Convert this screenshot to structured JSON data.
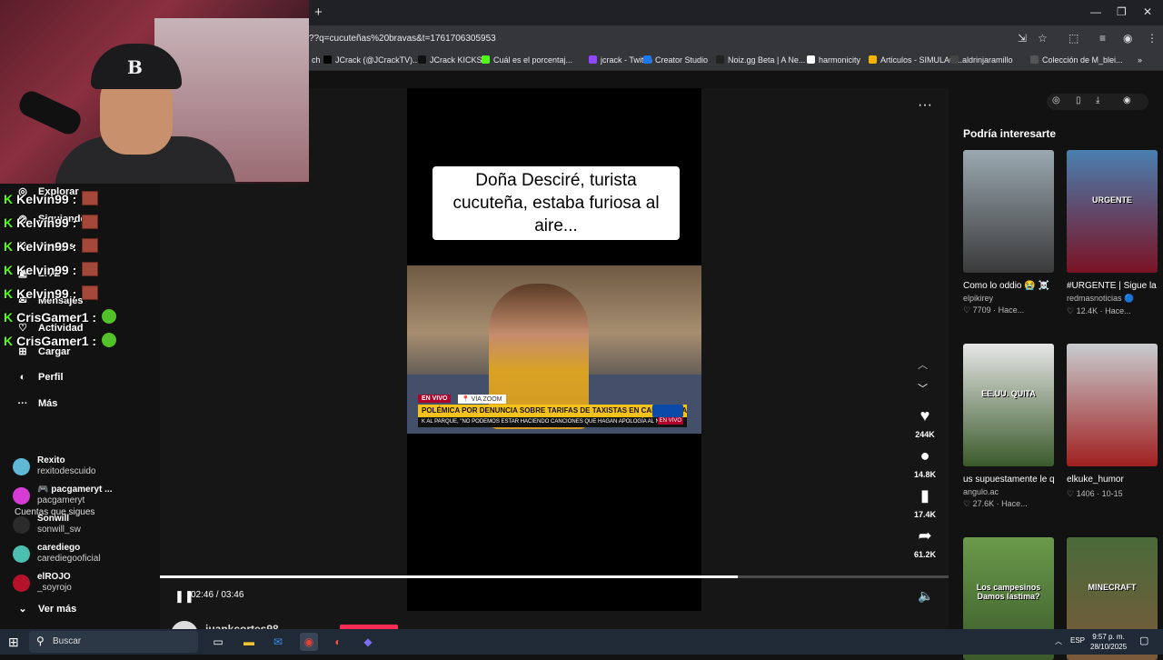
{
  "browser": {
    "new_tab_glyph": "+",
    "url": "??q=cucuteñas%20bravas&t=1761706305953",
    "window_controls": [
      "—",
      "❐",
      "✕"
    ],
    "bookmarks": [
      {
        "label": "ch",
        "color": "#555555"
      },
      {
        "label": "JCrack (@JCrackTV)...",
        "color": "#000000"
      },
      {
        "label": "JCrack KICKS",
        "color": "#111111"
      },
      {
        "label": "Cuál es el porcentaj...",
        "color": "#53fc18"
      },
      {
        "label": "jcrack - Twitch",
        "color": "#9146ff"
      },
      {
        "label": "Creator Studio",
        "color": "#1877f2"
      },
      {
        "label": "Noiz.gg Beta | A Ne...",
        "color": "#222222"
      },
      {
        "label": "harmonicity",
        "color": "#ffffff"
      },
      {
        "label": "Articulos - SIMULAC...",
        "color": "#f4b400"
      },
      {
        "label": "aldrinjaramillo",
        "color": "#444444"
      },
      {
        "label": "Colección de M_blei...",
        "color": "#555555"
      }
    ],
    "bookmarks_overflow": "»"
  },
  "sidebar": {
    "nav": [
      {
        "icon": "compass-icon",
        "glyph": "◎",
        "label": "Explorar"
      },
      {
        "icon": "following-icon",
        "glyph": "◉",
        "label": "Siguiendo"
      },
      {
        "icon": "friends-icon",
        "glyph": "⚇",
        "label": "Amigos"
      },
      {
        "icon": "live-icon",
        "glyph": "▣",
        "label": "LIVE"
      },
      {
        "icon": "messages-icon",
        "glyph": "✉",
        "label": "Mensajes"
      },
      {
        "icon": "activity-icon",
        "glyph": "♡",
        "label": "Actividad"
      },
      {
        "icon": "upload-icon",
        "glyph": "⊞",
        "label": "Cargar"
      },
      {
        "icon": "profile-icon",
        "glyph": "◐",
        "label": "Perfil"
      },
      {
        "icon": "more-icon",
        "glyph": "···",
        "label": "Más"
      }
    ],
    "following_title": "Cuentas que sigues",
    "accounts": [
      {
        "name": "Rexito",
        "handle": "rexitodescuido",
        "color": "#5fb8d6"
      },
      {
        "name": "🎮 pacgameryt ...",
        "handle": "pacgameryt",
        "color": "#d63bd6"
      },
      {
        "name": "Sonwill",
        "handle": "sonwill_sw",
        "color": "#2b2b2b"
      },
      {
        "name": "carediego",
        "handle": "carediegooficial",
        "color": "#4dbfb0"
      },
      {
        "name": "elROJO",
        "handle": "_soyrojo",
        "color": "#b3122a"
      }
    ],
    "see_more": "Ver más",
    "see_more_glyph": "⌄"
  },
  "chat": [
    {
      "user": "Kelvin99 :",
      "emote": "box"
    },
    {
      "user": "Kelvin99 :",
      "emote": "box"
    },
    {
      "user": "Kelvin99 :",
      "emote": "box"
    },
    {
      "user": "Kelvin99 :",
      "emote": "box"
    },
    {
      "user": "Kelvin99 :",
      "emote": "box"
    },
    {
      "user": "CrisGamer1 :",
      "emote": "green"
    },
    {
      "user": "CrisGamer1 :",
      "emote": "green"
    }
  ],
  "player": {
    "caption": "Doña Desciré, turista cucuteña, estaba furiosa al aire...",
    "lower_third": {
      "badge": "EN VIVO",
      "via": "📍 VÍA ZOOM",
      "headline": "POLÉMICA POR DENUNCIA SOBRE TARIFAS DE TAXISTAS EN CARTAGENA",
      "ticker": "K AL PARQUE, \"NO PODEMOS ESTAR HACIENDO CANCIONES QUE HAGAN APOLOGÍA AL NAR",
      "badge2": "EN VIVO"
    },
    "more_glyph": "···",
    "likes": "244K",
    "comments": "14.8K",
    "saves": "17.4K",
    "shares": "61.2K",
    "time": "02:46 / 03:46",
    "progress": 0.733,
    "pause_glyph": "❚❚",
    "volume_glyph": "🔈",
    "author": "juankcortes98"
  },
  "right_panel": {
    "title": "Podría interesarte",
    "cards": [
      {
        "title": "Como lo oddio 😭 ☠️",
        "user": "elpikirey",
        "stats": "♡ 7709 · Hace...",
        "colors": [
          "#9aa8b0",
          "#3a3a3a"
        ],
        "overlay": ""
      },
      {
        "title": "#URGENTE | Sigue la tensión en el Carib...",
        "user": "redmasnoticias 🔵",
        "stats": "♡ 12.4K · Hace...",
        "colors": [
          "#4a7fb0",
          "#7a1224"
        ],
        "overlay": "URGENTE"
      },
      {
        "title": "us supuestamente le quita la ayuda a...",
        "user": "angulo.ac",
        "stats": "♡ 27.6K · Hace...",
        "colors": [
          "#e6e6e6",
          "#3a5a2a"
        ],
        "overlay": "EE.UU. QUITA"
      },
      {
        "title": "elkuke_humor",
        "user": "",
        "stats": "♡ 1406 · 10-15",
        "colors": [
          "#c8ccd0",
          "#a02020"
        ],
        "overlay": ""
      },
      {
        "title": "",
        "user": "",
        "stats": "",
        "colors": [
          "#6a9a4a",
          "#3a5a2a"
        ],
        "overlay": "Los campesinos Damos lastima?"
      },
      {
        "title": "",
        "user": "",
        "stats": "",
        "colors": [
          "#4a6a3a",
          "#7a5a3a"
        ],
        "overlay": "MINECRAFT"
      }
    ]
  },
  "taskbar": {
    "search_placeholder": "Buscar",
    "lang": "ESP",
    "time": "9:57 p. m.",
    "date": "28/10/2025"
  }
}
